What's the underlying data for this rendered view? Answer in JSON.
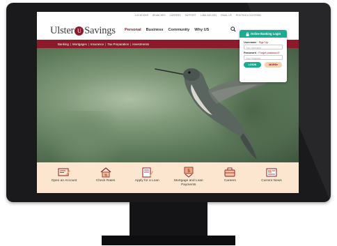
{
  "topbar": {
    "items": [
      "LOCATIONS",
      "BRANCHES",
      "CAREERS",
      "SUPPORT",
      "1.866.440.0391",
      "EMAIL US",
      "ROUTING # 221970984"
    ]
  },
  "header": {
    "logo_left": "Ulster",
    "logo_badge": "U",
    "logo_right": "Savings",
    "nav": [
      "Personal",
      "Business",
      "Community",
      "Why US"
    ],
    "active_nav": "Personal"
  },
  "subnav": {
    "items": [
      "Banking",
      "Mortgages",
      "Insurance",
      "Tax Preparation",
      "Investments"
    ]
  },
  "login": {
    "title": "Online Banking Login",
    "username_label": "Username",
    "signup_link": "Sign Up",
    "username_placeholder": "Your Username",
    "password_label": "Password",
    "forgot_link": "Forgot password?",
    "password_placeholder": "Your Password",
    "login_button": "LOGIN",
    "more_button": "MORE"
  },
  "actions": [
    {
      "label": "Open an Account",
      "icon": "open-account-icon"
    },
    {
      "label": "Check Rates",
      "icon": "house-rates-icon"
    },
    {
      "label": "Apply for a Loan",
      "icon": "loan-form-icon"
    },
    {
      "label": "Mortgage and Loan Payments",
      "icon": "payment-icon"
    },
    {
      "label": "Careers",
      "icon": "careers-icon"
    },
    {
      "label": "Current News",
      "icon": "news-icon"
    }
  ],
  "colors": {
    "brand": "#8b1b2b",
    "accent": "#1eaa92",
    "action_bar": "#fde6cf"
  }
}
